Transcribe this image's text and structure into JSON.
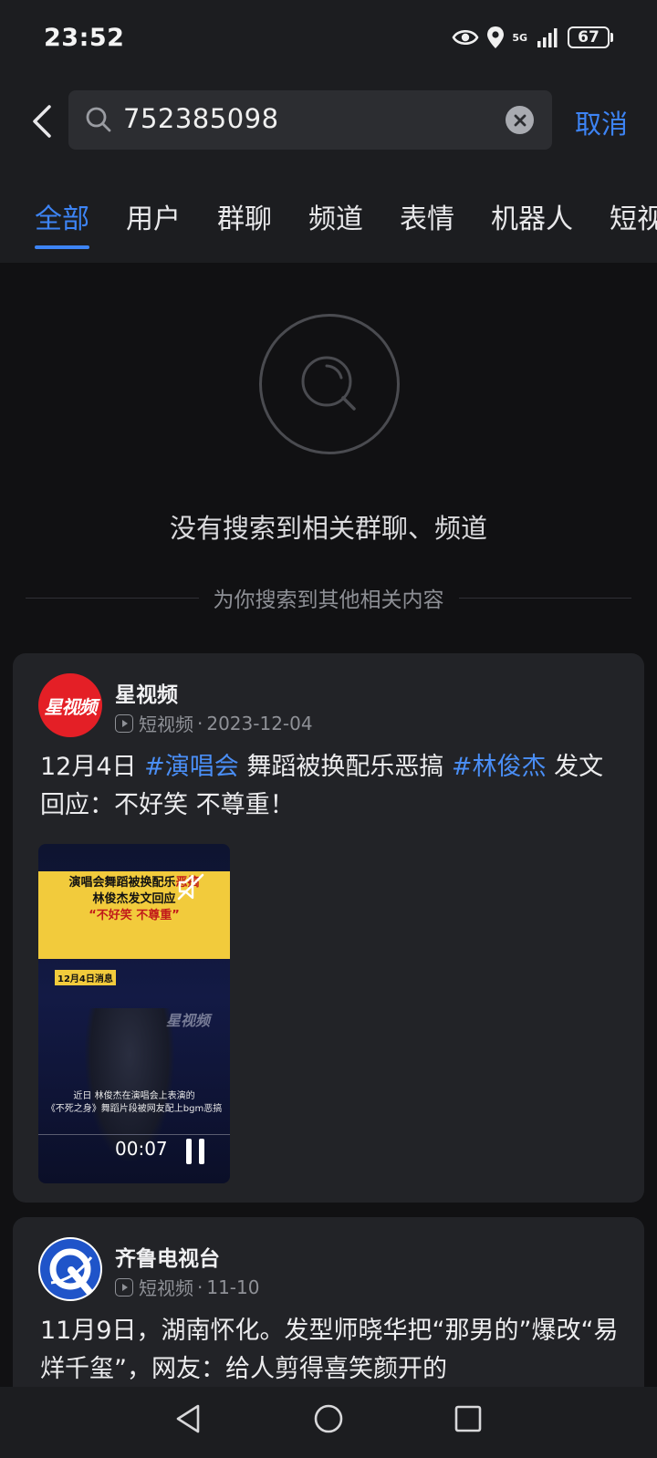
{
  "status_bar": {
    "time": "23:52",
    "network": "5G",
    "battery": "67",
    "icons": [
      "eye-icon",
      "location-icon",
      "signal-icon",
      "battery-icon"
    ]
  },
  "search": {
    "query": "752385098",
    "cancel_label": "取消"
  },
  "tabs": [
    {
      "label": "全部",
      "active": true
    },
    {
      "label": "用户",
      "active": false
    },
    {
      "label": "群聊",
      "active": false
    },
    {
      "label": "频道",
      "active": false
    },
    {
      "label": "表情",
      "active": false
    },
    {
      "label": "机器人",
      "active": false
    },
    {
      "label": "短视",
      "active": false
    }
  ],
  "empty_state": {
    "message": "没有搜索到相关群聊、频道",
    "divider_text": "为你搜索到其他相关内容"
  },
  "results": [
    {
      "publisher": "星视频",
      "avatar_text": "星视频",
      "type": "短视频",
      "separator": "·",
      "date": "2023-12-04",
      "text_parts": [
        {
          "text": "12月4日 ",
          "tag": false
        },
        {
          "text": "#演唱会",
          "tag": true
        },
        {
          "text": " 舞蹈被换配乐恶搞 ",
          "tag": false
        },
        {
          "text": "#林俊杰",
          "tag": true
        },
        {
          "text": " 发文回应：不好笑 不尊重！",
          "tag": false
        }
      ],
      "video": {
        "title_line1_a": "演唱会舞蹈被换配乐",
        "title_line1_b": "恶搞",
        "title_line2": "林俊杰发文回应",
        "title_line3": "“不好笑 不尊重”",
        "badge": "12月4日消息",
        "logo": "星视频",
        "subtitle_line1": "近日 林俊杰在演唱会上表演的",
        "subtitle_line2": "《不死之身》舞蹈片段被网友配上bgm恶搞",
        "duration": "00:07"
      }
    },
    {
      "publisher": "齐鲁电视台",
      "type": "短视频",
      "separator": "·",
      "date": "11-10",
      "text_parts": [
        {
          "text": "11月9日，湖南怀化。发型师晓华把“那男的”爆改“易烊千玺”，网友：给人剪得喜笑颜开的",
          "tag": false
        }
      ]
    }
  ],
  "nav_bar": {
    "icons": [
      "back-triangle-icon",
      "home-circle-icon",
      "recents-square-icon"
    ]
  },
  "colors": {
    "accent": "#3d84f5",
    "background": "#111113",
    "card": "#222327"
  }
}
